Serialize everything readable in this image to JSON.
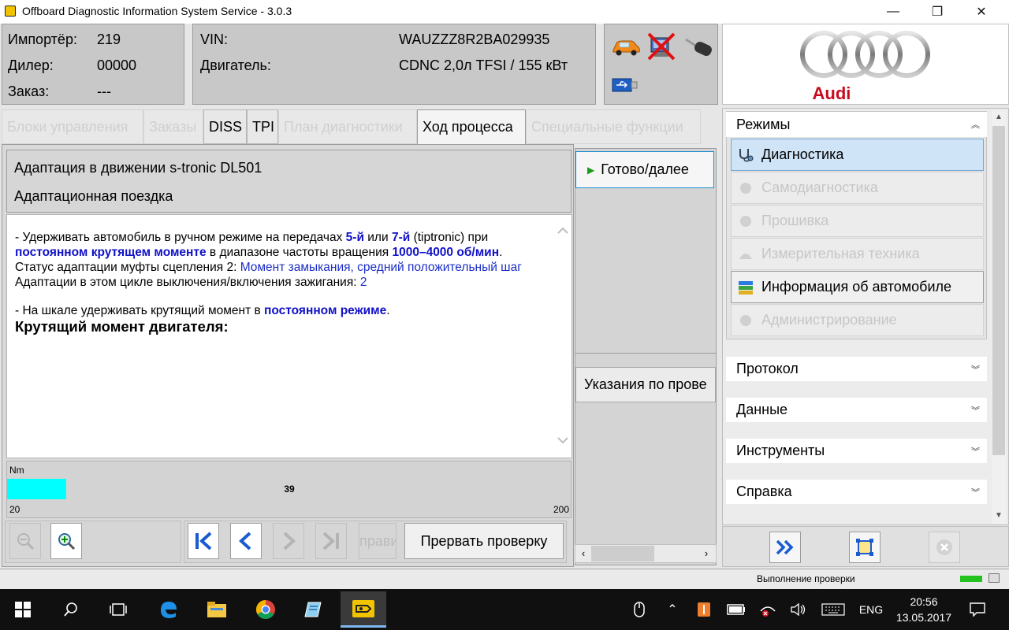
{
  "window": {
    "title": "Offboard Diagnostic Information System Service - 3.0.3",
    "minimize_symbol": "—",
    "maximize_symbol": "❐",
    "close_symbol": "✕"
  },
  "header": {
    "importer_label": "Импортёр:",
    "importer_value": "219",
    "dealer_label": "Дилер:",
    "dealer_value": "00000",
    "order_label": "Заказ:",
    "order_value": "---",
    "vin_label": "VIN:",
    "vin_value": "WAUZZZ8R2BA029935",
    "engine_label": "Двигатель:",
    "engine_value": "CDNC 2,0л TFSI / 155 кВт",
    "brand": "Audi"
  },
  "tabs": [
    {
      "label": "Блоки управления"
    },
    {
      "label": "Заказы"
    },
    {
      "label": "DISS"
    },
    {
      "label": "TPI"
    },
    {
      "label": "План диагностики"
    },
    {
      "label": "Ход процесса"
    },
    {
      "label": "Специальные функции"
    }
  ],
  "step": {
    "title": "Адаптация в движении s-tronic DL501",
    "subtitle": "Адаптационная поездка"
  },
  "content": {
    "l1_a": "- Удерживать автомобиль в ручном режиме на передачах ",
    "l1_b": "5-й",
    "l1_c": " или ",
    "l1_d": "7-й",
    "l1_e": " (tiptronic) при",
    "l2_a": "постоянном крутящем моменте",
    "l2_b": " в диапазоне частоты вращения ",
    "l2_c": "1000–4000 об/мин",
    "l2_d": ".",
    "l3_a": "Статус адаптации муфты сцепления 2: ",
    "l3_b": "Момент замыкания, средний положительный шаг",
    "l4_a": "Адаптации в этом цикле выключения/включения зажигания: ",
    "l4_b": "2",
    "l5_a": "- На шкале удерживать крутящий момент в ",
    "l5_b": "постоянном режиме",
    "l5_c": ".",
    "heading": "Крутящий момент двигателя:"
  },
  "gauge": {
    "unit": "Nm",
    "min": "20",
    "max": "200",
    "value": 39,
    "value_label": "39",
    "fill_fraction": 0.105,
    "color": "#00ffff"
  },
  "toolbar": {
    "partial_label": "прави",
    "abort_label": "Прервать проверку"
  },
  "side": {
    "ready_label": "Готово/далее",
    "hints_label": "Указания по прове"
  },
  "nav": {
    "modes_title": "Режимы",
    "modes": [
      {
        "label": "Диагностика",
        "icon": "stethoscope-icon"
      },
      {
        "label": "Самодиагностика",
        "icon": "gear-icon"
      },
      {
        "label": "Прошивка",
        "icon": "flash-icon"
      },
      {
        "label": "Измерительная техника",
        "icon": "meter-icon"
      },
      {
        "label": "Информация об автомобиле",
        "icon": "books-icon"
      },
      {
        "label": "Администрирование",
        "icon": "settings-icon"
      }
    ],
    "sections": [
      {
        "label": "Протокол"
      },
      {
        "label": "Данные"
      },
      {
        "label": "Инструменты"
      },
      {
        "label": "Справка"
      }
    ]
  },
  "status": {
    "text": "Выполнение проверки"
  },
  "taskbar": {
    "lang": "ENG",
    "time": "20:56",
    "date": "13.05.2017"
  },
  "colors": {
    "accent_blue": "#1c2fc7",
    "gauge_fill": "#00ffff",
    "audi_red": "#c80a1e"
  }
}
